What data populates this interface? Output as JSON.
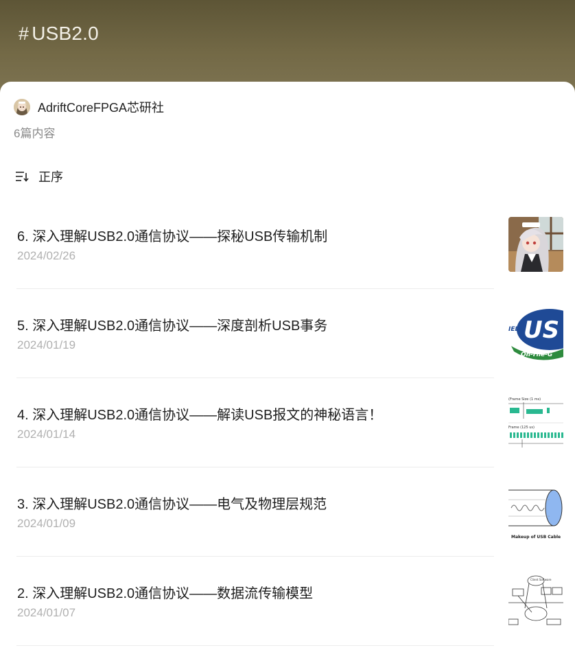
{
  "header": {
    "hash": "#",
    "title": "USB2.0"
  },
  "author": {
    "name": "AdriftCoreFPGA芯研社"
  },
  "count_text": "6篇内容",
  "sort": {
    "label": "正序"
  },
  "articles": [
    {
      "title": "6. 深入理解USB2.0通信协议——探秘USB传输机制",
      "date": "2024/02/26",
      "thumb": "anime-girl-image"
    },
    {
      "title": "5. 深入理解USB2.0通信协议——深度剖析USB事务",
      "date": "2024/01/19",
      "thumb": "usb-otg-logo-image"
    },
    {
      "title": "4. 深入理解USB2.0通信协议——解读USB报文的神秘语言！",
      "date": "2024/01/14",
      "thumb": "timing-diagram-image"
    },
    {
      "title": "3. 深入理解USB2.0通信协议——电气及物理层规范",
      "date": "2024/01/09",
      "thumb": "usb-cable-diagram-image"
    },
    {
      "title": "2. 深入理解USB2.0通信协议——数据流传输模型",
      "date": "2024/01/07",
      "thumb": "dataflow-diagram-image"
    }
  ],
  "thumb_text": {
    "usb_logo": "US",
    "usb_logo_side": "IED",
    "usb_logo_ribbon": "On-The-G",
    "timing_top": "(Frame Size (1 ms)",
    "timing_mid": "Frame (125 us)",
    "cable_caption": "Makeup of USB Cable",
    "flow_top": "Client Software"
  }
}
